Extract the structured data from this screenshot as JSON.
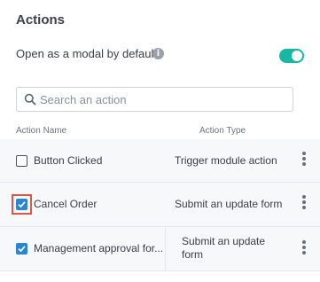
{
  "title": "Actions",
  "modal_setting": {
    "label": "Open as a modal by default",
    "info_glyph": "i",
    "enabled": true
  },
  "search": {
    "placeholder": "Search an action",
    "value": ""
  },
  "table": {
    "columns": [
      "Action Name",
      "Action Type"
    ],
    "rows": [
      {
        "name": "Button Clicked",
        "type": "Trigger module action",
        "checked": false
      },
      {
        "name": "Cancel Order",
        "type": "Submit an update form",
        "checked": true
      },
      {
        "name": "Management approval for...",
        "type_line1": "Submit an update",
        "type_line2": "form",
        "checked": true
      }
    ]
  },
  "colors": {
    "toggle_on": "#17b8a3",
    "checkbox_checked": "#2a86d1",
    "focus_outline": "#e25445"
  }
}
